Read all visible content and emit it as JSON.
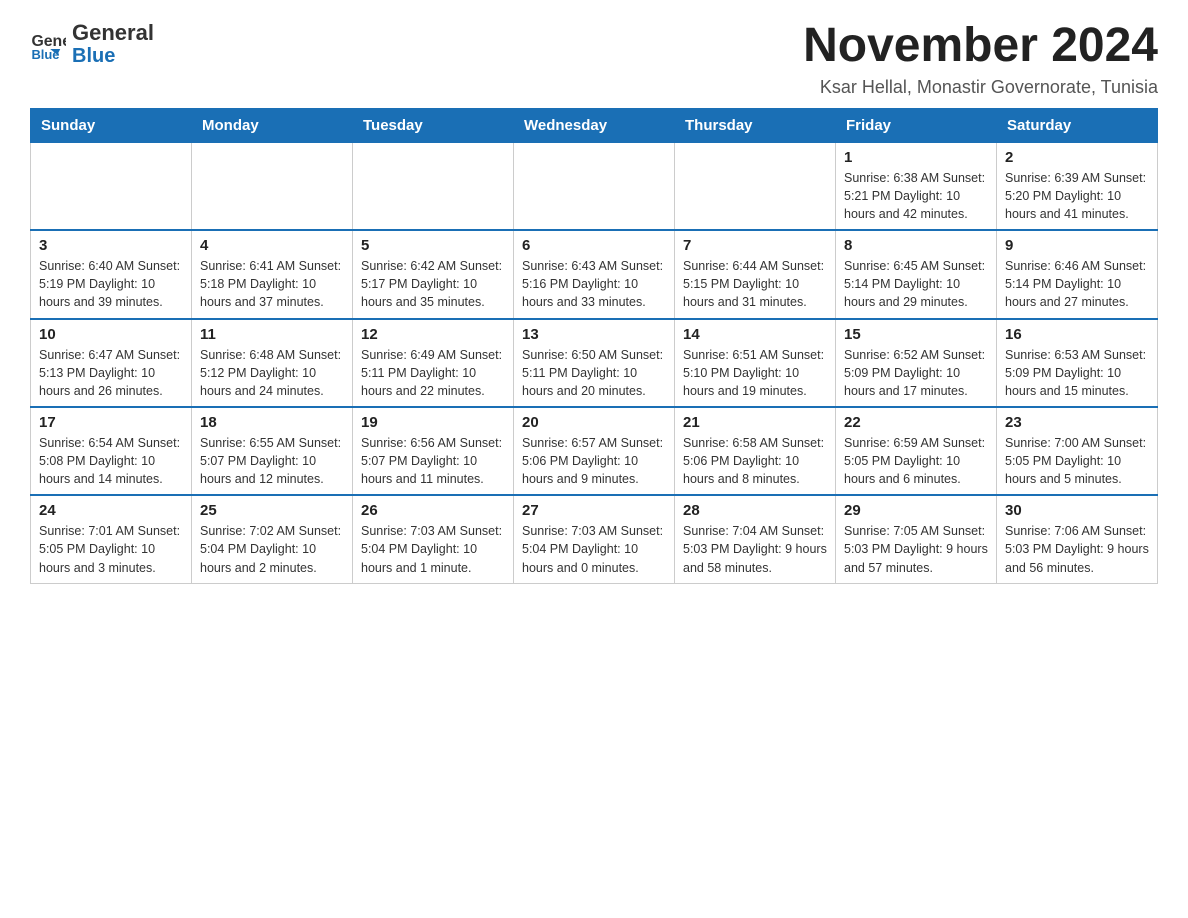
{
  "header": {
    "logo_line1": "General",
    "logo_line2": "Blue",
    "month_title": "November 2024",
    "location": "Ksar Hellal, Monastir Governorate, Tunisia"
  },
  "weekdays": [
    "Sunday",
    "Monday",
    "Tuesday",
    "Wednesday",
    "Thursday",
    "Friday",
    "Saturday"
  ],
  "weeks": [
    [
      {
        "day": "",
        "info": ""
      },
      {
        "day": "",
        "info": ""
      },
      {
        "day": "",
        "info": ""
      },
      {
        "day": "",
        "info": ""
      },
      {
        "day": "",
        "info": ""
      },
      {
        "day": "1",
        "info": "Sunrise: 6:38 AM\nSunset: 5:21 PM\nDaylight: 10 hours and 42 minutes."
      },
      {
        "day": "2",
        "info": "Sunrise: 6:39 AM\nSunset: 5:20 PM\nDaylight: 10 hours and 41 minutes."
      }
    ],
    [
      {
        "day": "3",
        "info": "Sunrise: 6:40 AM\nSunset: 5:19 PM\nDaylight: 10 hours and 39 minutes."
      },
      {
        "day": "4",
        "info": "Sunrise: 6:41 AM\nSunset: 5:18 PM\nDaylight: 10 hours and 37 minutes."
      },
      {
        "day": "5",
        "info": "Sunrise: 6:42 AM\nSunset: 5:17 PM\nDaylight: 10 hours and 35 minutes."
      },
      {
        "day": "6",
        "info": "Sunrise: 6:43 AM\nSunset: 5:16 PM\nDaylight: 10 hours and 33 minutes."
      },
      {
        "day": "7",
        "info": "Sunrise: 6:44 AM\nSunset: 5:15 PM\nDaylight: 10 hours and 31 minutes."
      },
      {
        "day": "8",
        "info": "Sunrise: 6:45 AM\nSunset: 5:14 PM\nDaylight: 10 hours and 29 minutes."
      },
      {
        "day": "9",
        "info": "Sunrise: 6:46 AM\nSunset: 5:14 PM\nDaylight: 10 hours and 27 minutes."
      }
    ],
    [
      {
        "day": "10",
        "info": "Sunrise: 6:47 AM\nSunset: 5:13 PM\nDaylight: 10 hours and 26 minutes."
      },
      {
        "day": "11",
        "info": "Sunrise: 6:48 AM\nSunset: 5:12 PM\nDaylight: 10 hours and 24 minutes."
      },
      {
        "day": "12",
        "info": "Sunrise: 6:49 AM\nSunset: 5:11 PM\nDaylight: 10 hours and 22 minutes."
      },
      {
        "day": "13",
        "info": "Sunrise: 6:50 AM\nSunset: 5:11 PM\nDaylight: 10 hours and 20 minutes."
      },
      {
        "day": "14",
        "info": "Sunrise: 6:51 AM\nSunset: 5:10 PM\nDaylight: 10 hours and 19 minutes."
      },
      {
        "day": "15",
        "info": "Sunrise: 6:52 AM\nSunset: 5:09 PM\nDaylight: 10 hours and 17 minutes."
      },
      {
        "day": "16",
        "info": "Sunrise: 6:53 AM\nSunset: 5:09 PM\nDaylight: 10 hours and 15 minutes."
      }
    ],
    [
      {
        "day": "17",
        "info": "Sunrise: 6:54 AM\nSunset: 5:08 PM\nDaylight: 10 hours and 14 minutes."
      },
      {
        "day": "18",
        "info": "Sunrise: 6:55 AM\nSunset: 5:07 PM\nDaylight: 10 hours and 12 minutes."
      },
      {
        "day": "19",
        "info": "Sunrise: 6:56 AM\nSunset: 5:07 PM\nDaylight: 10 hours and 11 minutes."
      },
      {
        "day": "20",
        "info": "Sunrise: 6:57 AM\nSunset: 5:06 PM\nDaylight: 10 hours and 9 minutes."
      },
      {
        "day": "21",
        "info": "Sunrise: 6:58 AM\nSunset: 5:06 PM\nDaylight: 10 hours and 8 minutes."
      },
      {
        "day": "22",
        "info": "Sunrise: 6:59 AM\nSunset: 5:05 PM\nDaylight: 10 hours and 6 minutes."
      },
      {
        "day": "23",
        "info": "Sunrise: 7:00 AM\nSunset: 5:05 PM\nDaylight: 10 hours and 5 minutes."
      }
    ],
    [
      {
        "day": "24",
        "info": "Sunrise: 7:01 AM\nSunset: 5:05 PM\nDaylight: 10 hours and 3 minutes."
      },
      {
        "day": "25",
        "info": "Sunrise: 7:02 AM\nSunset: 5:04 PM\nDaylight: 10 hours and 2 minutes."
      },
      {
        "day": "26",
        "info": "Sunrise: 7:03 AM\nSunset: 5:04 PM\nDaylight: 10 hours and 1 minute."
      },
      {
        "day": "27",
        "info": "Sunrise: 7:03 AM\nSunset: 5:04 PM\nDaylight: 10 hours and 0 minutes."
      },
      {
        "day": "28",
        "info": "Sunrise: 7:04 AM\nSunset: 5:03 PM\nDaylight: 9 hours and 58 minutes."
      },
      {
        "day": "29",
        "info": "Sunrise: 7:05 AM\nSunset: 5:03 PM\nDaylight: 9 hours and 57 minutes."
      },
      {
        "day": "30",
        "info": "Sunrise: 7:06 AM\nSunset: 5:03 PM\nDaylight: 9 hours and 56 minutes."
      }
    ]
  ]
}
